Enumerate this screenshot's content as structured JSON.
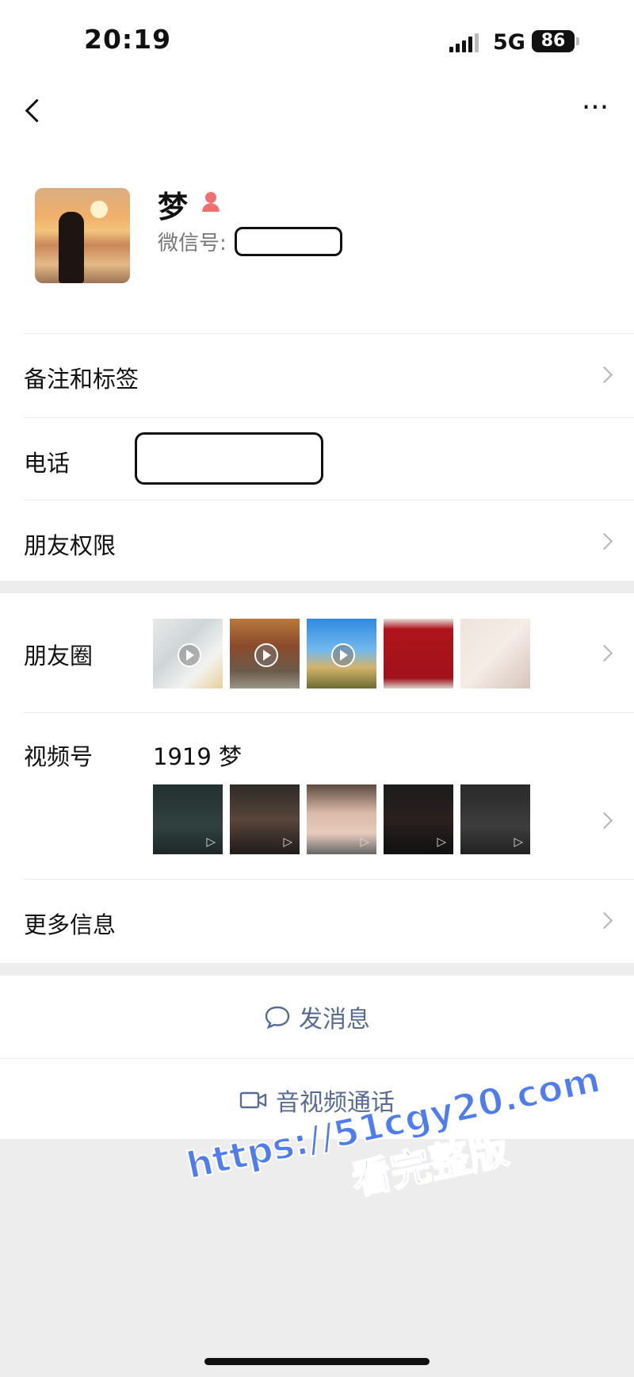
{
  "status": {
    "time": "20:19",
    "network": "5G",
    "battery": "86"
  },
  "nav": {
    "back_icon": "chevron-left-icon",
    "more_icon": "more-dots-icon",
    "more_label": "···"
  },
  "profile": {
    "name": "梦",
    "gender_icon": "female-icon",
    "wechat_id_label": "微信号:"
  },
  "rows": {
    "remark_tags": "备注和标签",
    "phone": "电话",
    "friend_permission": "朋友权限",
    "moments": "朋友圈",
    "channels": "视频号",
    "channels_name": "1919 梦",
    "more_info": "更多信息"
  },
  "actions": {
    "send_message": "发消息",
    "av_call": "音视频通话"
  },
  "watermark": {
    "line1": "https://51cgy20.com",
    "line2": "看完整版"
  },
  "colors": {
    "link": "#576b95",
    "background": "#ededed",
    "watermark": "#4f7df0",
    "female": "#f0706f"
  }
}
